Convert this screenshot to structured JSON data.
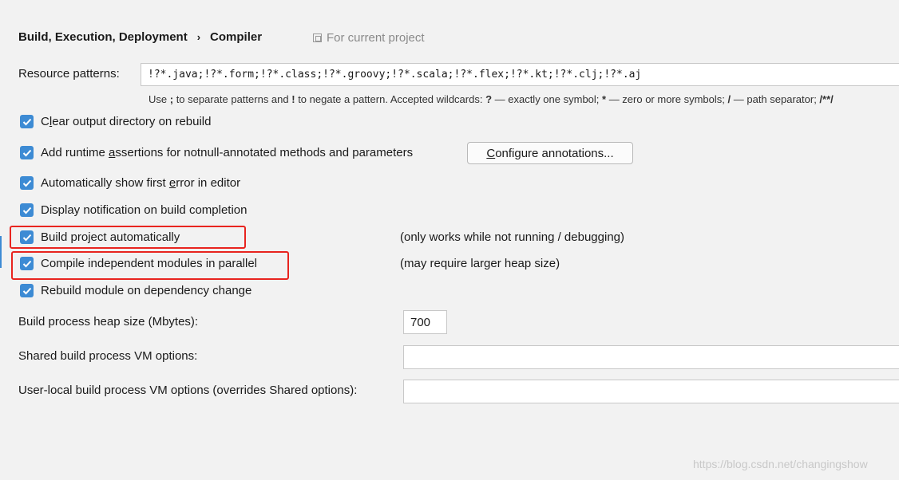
{
  "breadcrumb": {
    "parent": "Build, Execution, Deployment",
    "separator": "›",
    "current": "Compiler"
  },
  "scope_label": "For current project",
  "resource_patterns": {
    "label": "Resource patterns:",
    "value": "!?*.java;!?*.form;!?*.class;!?*.groovy;!?*.scala;!?*.flex;!?*.kt;!?*.clj;!?*.aj",
    "hint": {
      "p1": "Use ",
      "k1": ";",
      "p2": " to separate patterns and ",
      "k2": "!",
      "p3": " to negate a pattern. Accepted wildcards: ",
      "k3": "?",
      "p4": " — exactly one symbol; ",
      "k4": "*",
      "p5": " — zero or more symbols; ",
      "k5": "/",
      "p6": " — path separator; ",
      "k6": "/**/"
    }
  },
  "options": {
    "clear_output": {
      "pre": "C",
      "mn": "l",
      "post": "ear output directory on rebuild",
      "checked": true
    },
    "runtime_assertions": {
      "pre": "Add runtime ",
      "mn": "a",
      "post": "ssertions for notnull-annotated methods and parameters",
      "checked": true
    },
    "show_first_error": {
      "pre": "Automatically show first ",
      "mn": "e",
      "post": "rror in editor",
      "checked": true
    },
    "notify_build": {
      "label": "Display notification on build completion",
      "checked": true
    },
    "build_auto": {
      "label": "Build project automatically",
      "checked": true,
      "note": "(only works while not running / debugging)"
    },
    "compile_parallel": {
      "label": "Compile independent modules in parallel",
      "checked": true,
      "note": "(may require larger heap size)"
    },
    "rebuild_on_dep": {
      "label": "Rebuild module on dependency change",
      "checked": true
    }
  },
  "configure_button": {
    "mn": "C",
    "rest": "onfigure annotations..."
  },
  "heap_size": {
    "label": "Build process heap size (Mbytes):",
    "value": "700"
  },
  "shared_vm": {
    "label": "Shared build process VM options:",
    "value": ""
  },
  "user_vm": {
    "label": "User-local build process VM options (overrides Shared options):",
    "value": ""
  },
  "watermark": "https://blog.csdn.net/changingshow",
  "colors": {
    "accent": "#3d8bd4",
    "highlight": "#e8241f",
    "background": "#f2f2f2"
  }
}
